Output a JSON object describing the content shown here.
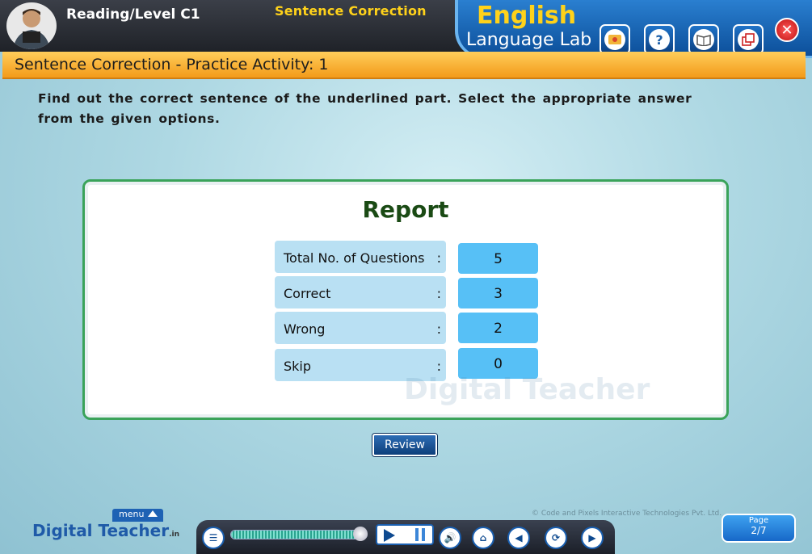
{
  "header": {
    "level": "Reading/Level C1",
    "topic": "Sentence Correction",
    "lab_title_1": "English",
    "lab_title_2": "Language Lab",
    "toolbar_icons": [
      "textbook-icon",
      "help-icon",
      "glossary-icon",
      "window-icon"
    ],
    "close_icon": "close-icon"
  },
  "titlebar": {
    "title": "Sentence Correction - Practice Activity: 1"
  },
  "instruction": "Find out the correct sentence of the underlined part. Select the appropriate answer from the given options.",
  "report": {
    "title": "Report",
    "rows": [
      {
        "label": "Total No. of Questions",
        "colon": ":",
        "value": "5"
      },
      {
        "label": "Correct",
        "colon": ":",
        "value": "3"
      },
      {
        "label": "Wrong",
        "colon": ":",
        "value": "2"
      },
      {
        "label": "Skip",
        "colon": ":",
        "value": "0"
      }
    ]
  },
  "review_button": "Review",
  "watermark": "Digital Teacher",
  "copyright": "© Code and Pixels Interactive Technologies  Pvt. Ltd.",
  "footer": {
    "brand": "Digital Teacher",
    "brand_suffix": ".in",
    "menu_label": "menu",
    "progress_fraction": 0.96,
    "page_label": "Page",
    "page_value": "2/7"
  },
  "colors": {
    "accent_orange": "#f39b1a",
    "brand_blue": "#1f5aa8",
    "report_green": "#3aa35a",
    "value_blue": "#57c0f6"
  }
}
